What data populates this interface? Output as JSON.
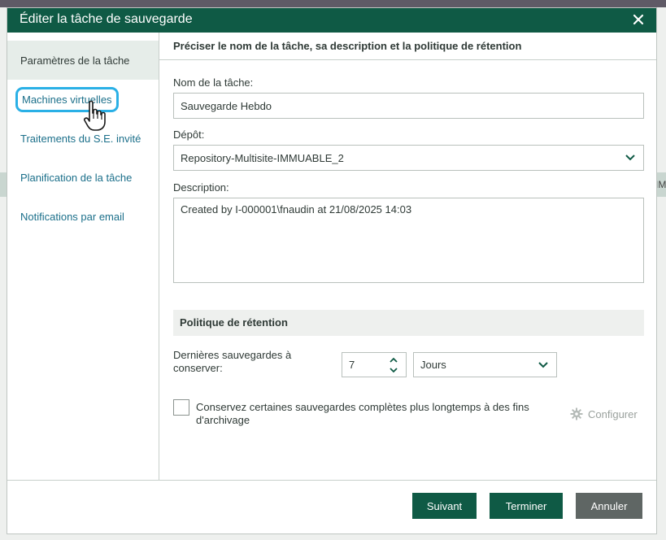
{
  "background": {
    "right_label": "IM"
  },
  "dialog": {
    "title": "Éditer la tâche de sauvegarde",
    "close_icon": "close-icon"
  },
  "sidebar": {
    "items": [
      {
        "label": "Paramètres de la tâche",
        "active": true
      },
      {
        "label": "Machines virtuelles",
        "focused": true
      },
      {
        "label": "Traitements du S.E. invité"
      },
      {
        "label": "Planification de la tâche"
      },
      {
        "label": "Notifications par email"
      }
    ]
  },
  "content": {
    "header": "Préciser le nom de la tâche, sa description et la politique de rétention",
    "job_name_label": "Nom de la tâche:",
    "job_name_value": "Sauvegarde Hebdo",
    "repository_label": "Dépôt:",
    "repository_value": "Repository-Multisite-IMMUABLE_2",
    "description_label": "Description:",
    "description_value": "Created by I-000001\\fnaudin at 21/08/2025 14:03",
    "retention_section": "Politique de rétention",
    "retention_label_line1": "Dernières sauvegardes à",
    "retention_label_line2": "conserver:",
    "retention_value": "7",
    "retention_unit": "Jours",
    "archive_checkbox_line1": "Conservez certaines sauvegardes complètes plus longtemps à des fins",
    "archive_checkbox_line2": "d'archivage",
    "configure_label": "Configurer"
  },
  "footer": {
    "next": "Suivant",
    "finish": "Terminer",
    "cancel": "Annuler"
  },
  "colors": {
    "titlebar": "#0f5a45",
    "link": "#1b6f8a",
    "focus_ring": "#2ab0e6",
    "cancel_button": "#5f6664"
  }
}
